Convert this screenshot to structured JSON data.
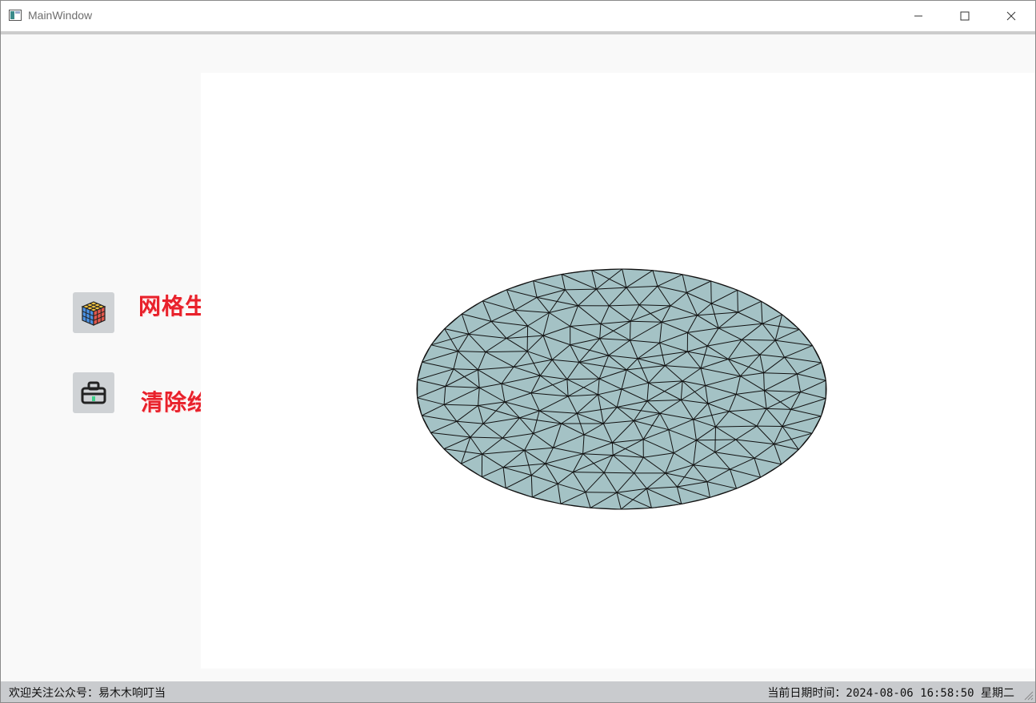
{
  "window": {
    "title": "MainWindow",
    "controls": {
      "minimize_icon": "minimize-icon",
      "maximize_icon": "maximize-icon",
      "close_icon": "close-icon"
    }
  },
  "toolbar": {
    "buttons": [
      {
        "label": "网格生成",
        "icon": "rubiks-cube-icon"
      },
      {
        "label": "清除绘图区",
        "icon": "eraser-toolbox-icon"
      }
    ]
  },
  "canvas": {
    "mesh_fill": "#a4c2c5",
    "mesh_stroke": "#111111"
  },
  "statusbar": {
    "left_text": "欢迎关注公众号：易木木响叮当",
    "right_text": "当前日期时间：2024-08-06 16:58:50 星期二"
  },
  "colors": {
    "accent_label": "#e8212b",
    "statusbar_bg": "#c9cbce"
  }
}
